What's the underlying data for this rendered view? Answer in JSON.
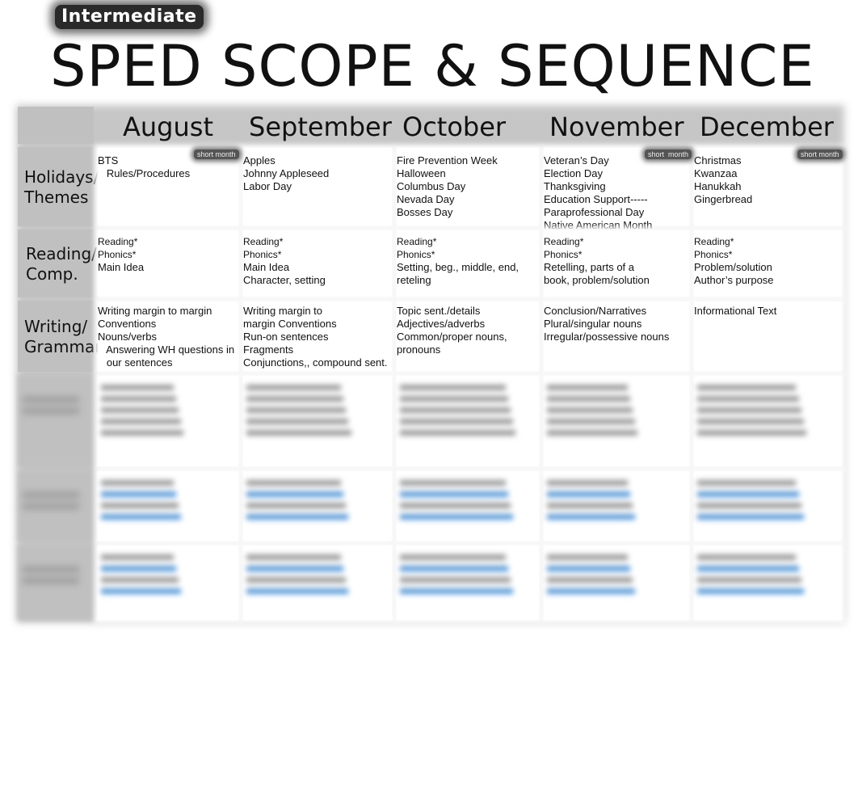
{
  "header": {
    "badge": "Intermediate",
    "title": "SPED SCOPE & SEQUENCE"
  },
  "months": [
    {
      "name": "August",
      "color": "#2ec8c8",
      "note": "short month"
    },
    {
      "name": "September",
      "color": "#c000f0",
      "note": ""
    },
    {
      "name": "October",
      "color": "#18ee18",
      "note": ""
    },
    {
      "name": "November",
      "color": "#f040a0",
      "note": "short  month"
    },
    {
      "name": "December",
      "color": "#f8c010",
      "note": "short month"
    }
  ],
  "rows": [
    {
      "label": [
        "Holidays/",
        "Themes"
      ],
      "cells": [
        [
          "BTS",
          "   Rules/Procedures"
        ],
        [
          "Apples",
          "Johnny Appleseed",
          "Labor Day"
        ],
        [
          "Fire Prevention Week",
          "Halloween",
          "Columbus Day",
          "Nevada Day",
          "Bosses Day"
        ],
        [
          "Veteran’s Day",
          "Election Day",
          "Thanksgiving",
          "Education Support-----",
          "Paraprofessional Day",
          "Native American Month"
        ],
        [
          "Christmas",
          "Kwanzaa",
          "Hanukkah",
          "Gingerbread"
        ]
      ]
    },
    {
      "label": [
        "Reading/",
        "Comp."
      ],
      "cells": [
        [
          "Reading*",
          "Phonics*",
          "Main Idea"
        ],
        [
          "Reading*",
          "Phonics*",
          "Main Idea",
          "Character, setting"
        ],
        [
          "Reading*",
          "Phonics*",
          "Setting, beg., middle, end,",
          "reteling"
        ],
        [
          "Reading*",
          "Phonics*",
          "Retelling, parts of a",
          "book, problem/solution"
        ],
        [
          "Reading*",
          "Phonics*",
          "Problem/solution",
          "Author’s purpose"
        ]
      ]
    },
    {
      "label": [
        "Writing/",
        "Grammar"
      ],
      "cells": [
        [
          "Writing margin to margin",
          "Conventions",
          "Nouns/verbs",
          "   Answering WH questions in",
          "   our sentences"
        ],
        [
          "Writing margin to",
          "margin Conventions",
          "Run-on sentences",
          "Fragments",
          "Conjunctions,, compound sent."
        ],
        [
          "Topic sent./details",
          "Adjectives/adverbs",
          "Common/proper nouns,",
          "pronouns"
        ],
        [
          "Conclusion/Narratives",
          "Plural/singular nouns",
          "Irregular/possessive nouns"
        ],
        [
          "Informational Text"
        ]
      ]
    }
  ]
}
